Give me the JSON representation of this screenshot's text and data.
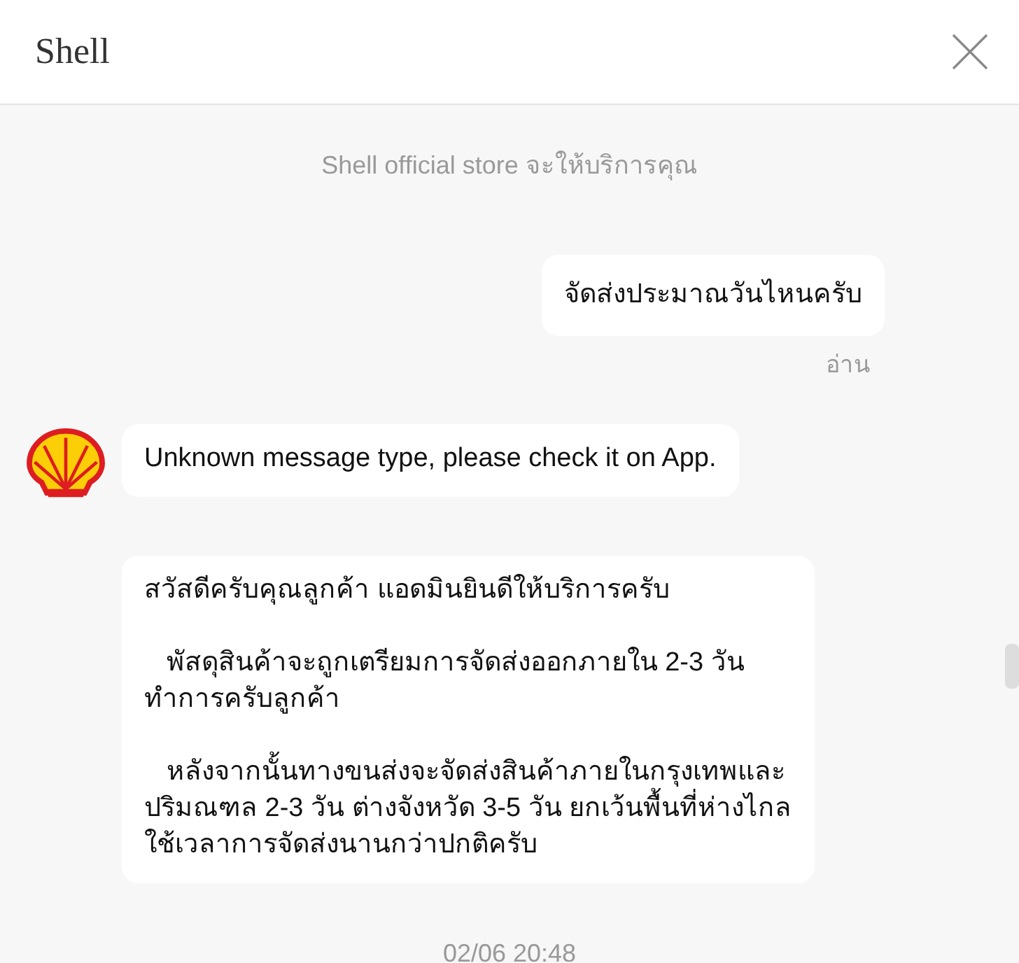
{
  "window": {
    "title": "Shell"
  },
  "notice": "Shell official store จะให้บริการคุณ",
  "messages": [
    {
      "kind": "outgoing",
      "text": "จัดส่งประมาณวันไหนครับ",
      "status": "อ่าน"
    },
    {
      "kind": "incoming",
      "avatar": true,
      "text": "Unknown message type, please check it on App."
    },
    {
      "kind": "incoming",
      "avatar": false,
      "text": "สวัสดีครับคุณลูกค้า แอดมินยินดีให้บริการครับ\n\n   พัสดุสินค้าจะถูกเตรียมการจัดส่งออกภายใน 2-3 วัน\nทำการครับลูกค้า\n\n   หลังจากนั้นทางขนส่งจะจัดส่งสินค้าภายในกรุงเทพและ\nปริมณฑล 2-3 วัน ต่างจังหวัด 3-5 วัน ยกเว้นพื้นที่ห่างไกล\nใช้เวลาการจัดส่งนานกว่าปกติครับ"
    }
  ],
  "timestamp": "02/06 20:48"
}
